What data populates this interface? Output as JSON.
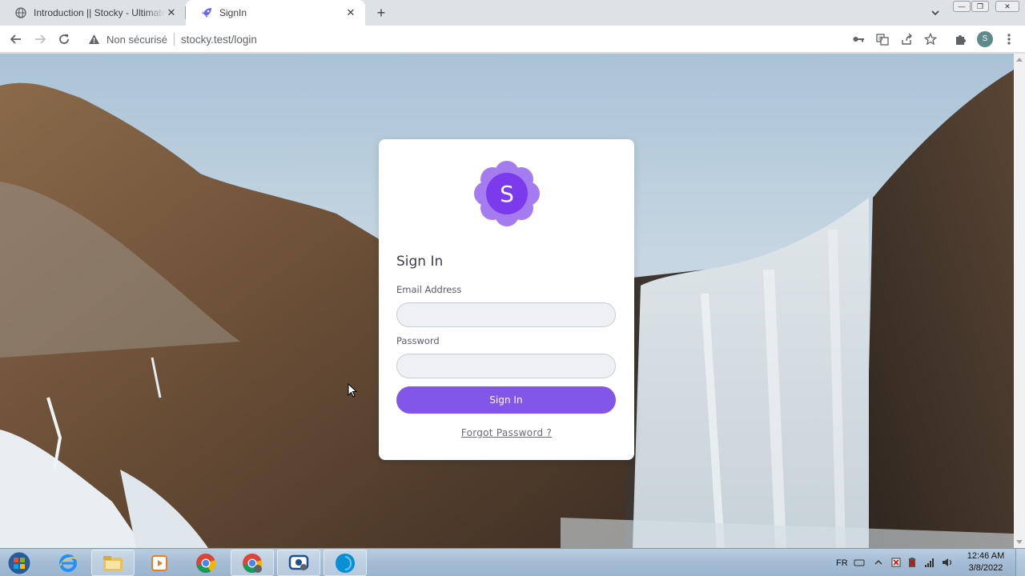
{
  "browser": {
    "tabs": [
      {
        "title": "Introduction || Stocky - Ultimate Inventory",
        "active": false
      },
      {
        "title": "SignIn",
        "active": true
      }
    ],
    "omnibox": {
      "security_label": "Non sécurisé",
      "url": "stocky.test/login"
    },
    "profile_initial": "S"
  },
  "login": {
    "logo_letter": "S",
    "title": "Sign In",
    "email_label": "Email Address",
    "email_value": "",
    "password_label": "Password",
    "password_value": "",
    "submit_label": "Sign In",
    "forgot_label": "Forgot Password ?"
  },
  "colors": {
    "accent": "#8156e9",
    "logo_outer": "#a57cf0",
    "logo_inner": "#7c3aed"
  },
  "taskbar": {
    "apps": [
      "start-orb",
      "internet-explorer",
      "file-explorer",
      "media-player",
      "chrome",
      "chrome-active",
      "screen-recorder",
      "app-blue"
    ],
    "language": "FR",
    "time": "12:46 AM",
    "date": "3/8/2022"
  }
}
